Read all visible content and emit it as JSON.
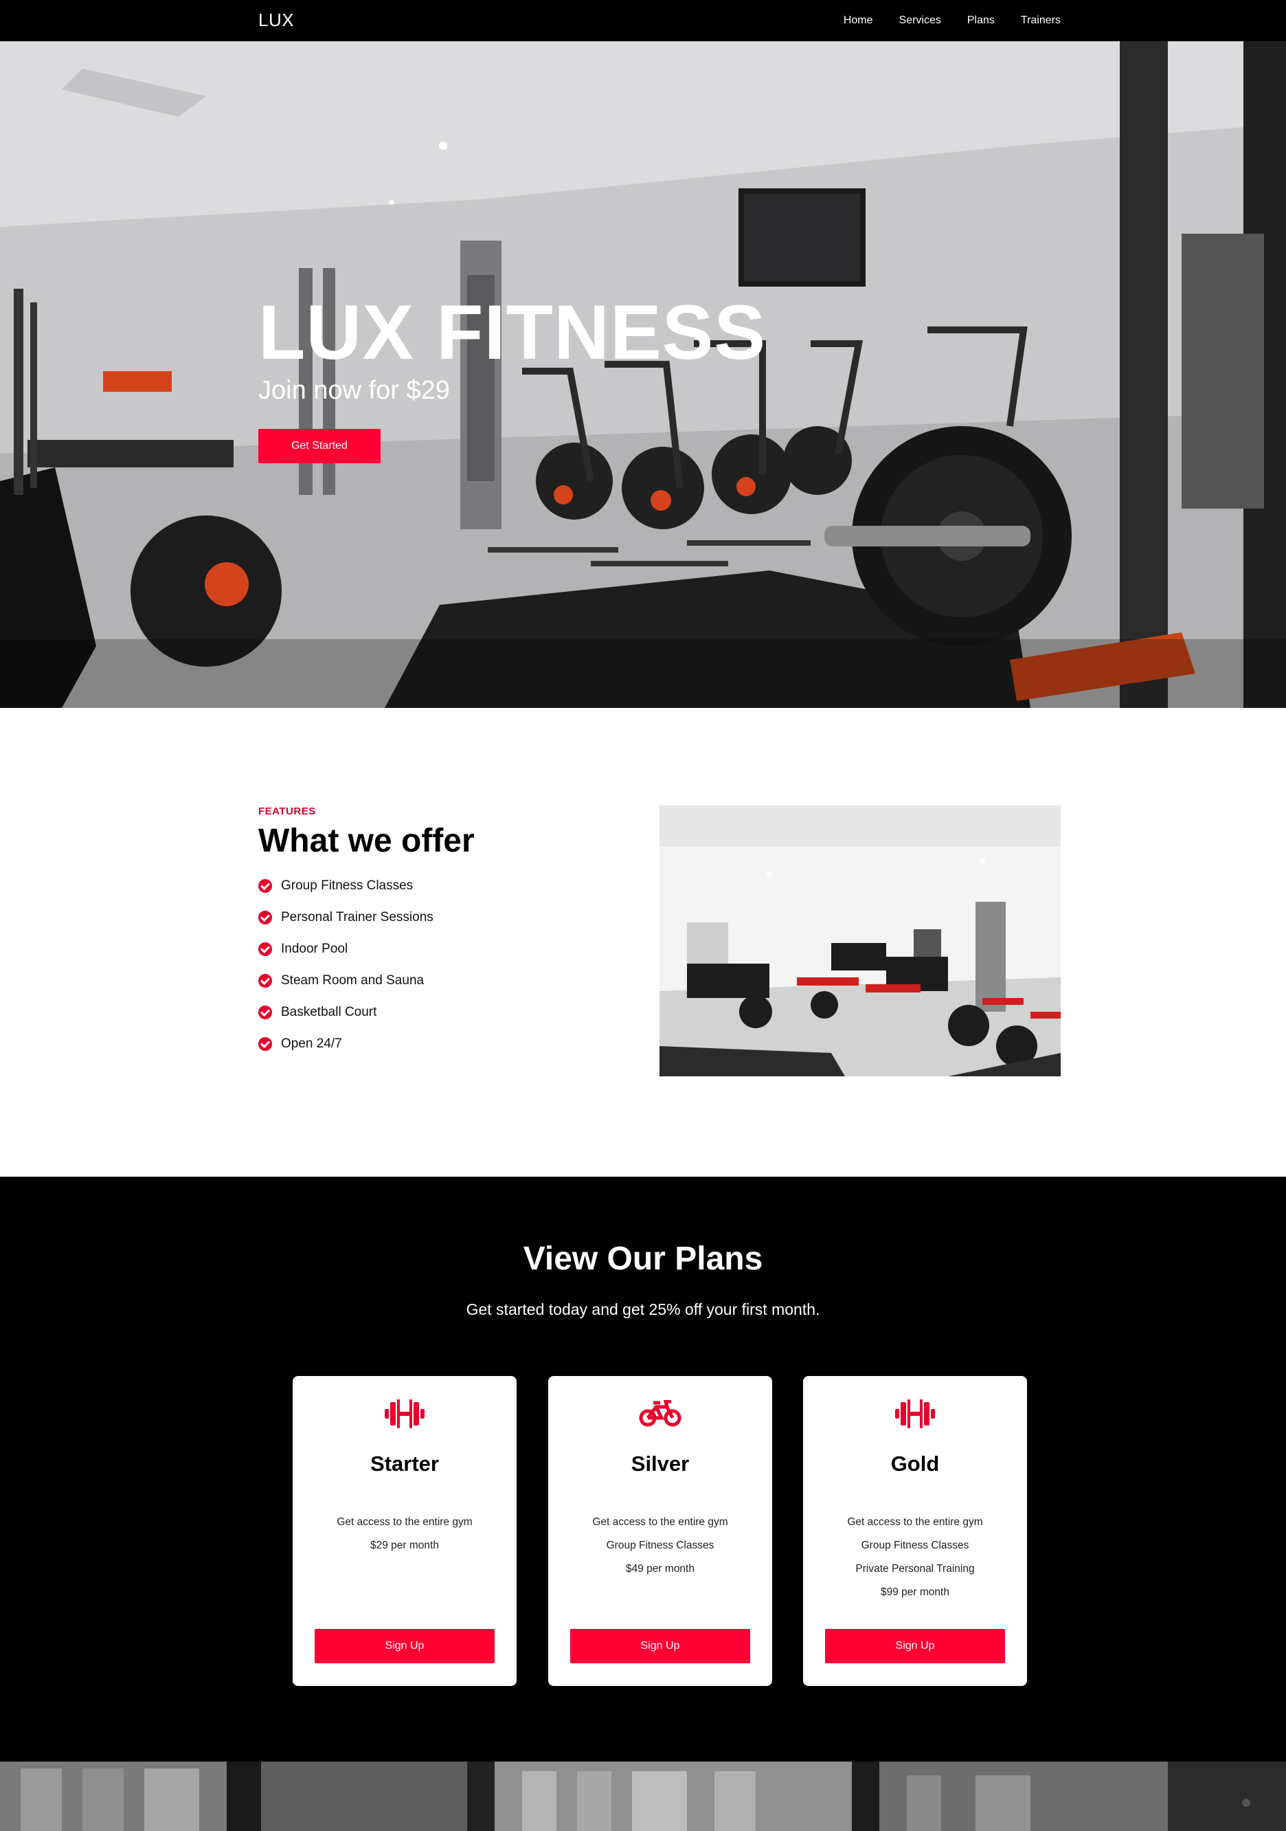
{
  "navbar": {
    "brand": "LUX",
    "links": [
      "Home",
      "Services",
      "Plans",
      "Trainers"
    ]
  },
  "hero": {
    "title": "LUX FITNESS",
    "subtitle": "Join now for $29",
    "cta_label": "Get Started"
  },
  "features": {
    "kicker": "FEATURES",
    "title": "What we offer",
    "items": [
      "Group Fitness Classes",
      "Personal Trainer Sessions",
      "Indoor Pool",
      "Steam Room and Sauna",
      "Basketball Court",
      "Open 24/7"
    ]
  },
  "plans": {
    "title": "View Our Plans",
    "subtitle": "Get started today and get 25% off your first month.",
    "cards": [
      {
        "icon": "dumbbell-icon",
        "name": "Starter",
        "lines": [
          "Get access to the entire gym",
          "$29 per month"
        ],
        "button": "Sign Up"
      },
      {
        "icon": "bicycle-icon",
        "name": "Silver",
        "lines": [
          "Get access to the entire gym",
          "Group Fitness Classes",
          "$49 per month"
        ],
        "button": "Sign Up"
      },
      {
        "icon": "dumbbell-icon",
        "name": "Gold",
        "lines": [
          "Get access to the entire gym",
          "Group Fitness Classes",
          "Private Personal Training",
          "$99 per month"
        ],
        "button": "Sign Up"
      }
    ]
  },
  "colors": {
    "accent": "#ff0033",
    "navbar_bg": "#000000",
    "plans_bg": "#000000",
    "features_bg": "#ffffff"
  }
}
